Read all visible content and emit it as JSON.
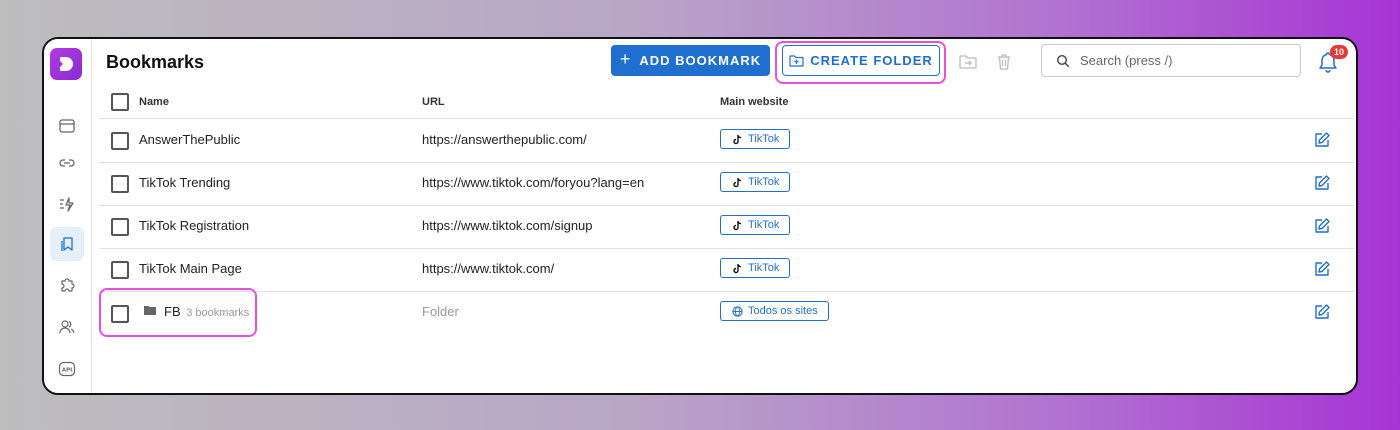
{
  "header": {
    "title": "Bookmarks",
    "add_bookmark_label": "ADD BOOKMARK",
    "create_folder_label": "CREATE FOLDER",
    "search_placeholder": "Search (press /)",
    "notification_count": "10"
  },
  "sidebar": {
    "items": [
      {
        "icon": "browser-window-icon"
      },
      {
        "icon": "link-icon"
      },
      {
        "icon": "automation-icon"
      },
      {
        "icon": "bookmarks-icon",
        "active": true
      },
      {
        "icon": "extension-icon"
      },
      {
        "icon": "users-icon"
      },
      {
        "icon": "api-icon"
      }
    ]
  },
  "table": {
    "columns": [
      "Name",
      "URL",
      "Main website"
    ],
    "rows": [
      {
        "name": "AnswerThePublic",
        "url": "https://answerthepublic.com/",
        "site": "TikTok"
      },
      {
        "name": "TikTok Trending",
        "url": "https://www.tiktok.com/foryou?lang=en",
        "site": "TikTok"
      },
      {
        "name": "TikTok Registration",
        "url": "https://www.tiktok.com/signup",
        "site": "TikTok"
      },
      {
        "name": "TikTok Main Page",
        "url": "https://www.tiktok.com/",
        "site": "TikTok"
      }
    ],
    "folder": {
      "name": "FB",
      "count": "3 bookmarks",
      "url": "Folder",
      "site": "Todos os sites"
    }
  },
  "colors": {
    "accent": "#1f6fd1",
    "highlight": "#e84fe0",
    "badge": "#e53935"
  }
}
